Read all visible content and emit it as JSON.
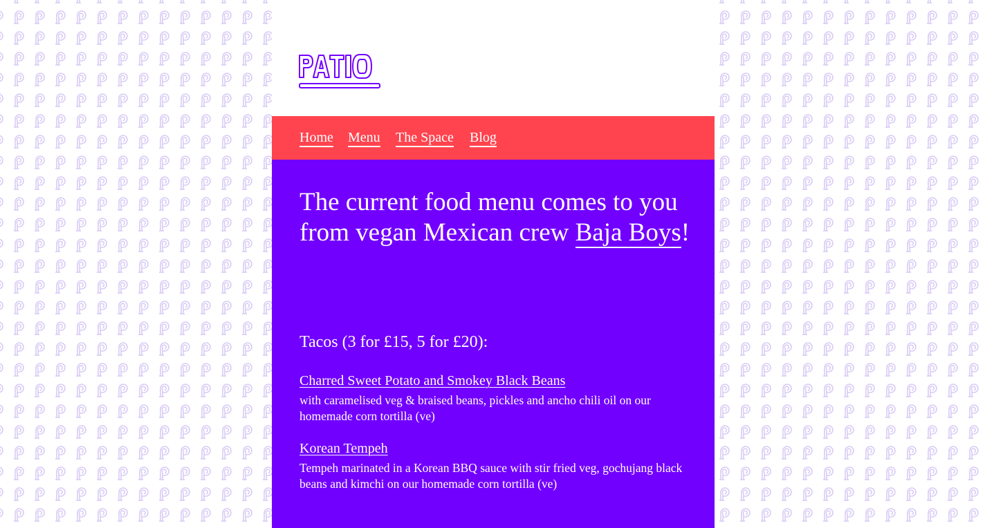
{
  "brand": {
    "logo_text": "PATIO",
    "logo_color": "#7200ff"
  },
  "colors": {
    "nav_bg": "#ff444f",
    "main_bg": "#7200ff",
    "pattern_icon": "#d9ccf5"
  },
  "nav": {
    "items": [
      {
        "label": "Home"
      },
      {
        "label": "Menu"
      },
      {
        "label": "The Space"
      },
      {
        "label": "Blog"
      }
    ]
  },
  "main": {
    "headline_prefix": "The current food menu comes to you from vegan Mexican crew ",
    "headline_link": "Baja Boys",
    "headline_suffix": "!",
    "section_title": "Tacos (3 for £15, 5 for £20):",
    "items": [
      {
        "name": "Charred Sweet Potato and Smokey Black Beans",
        "description": "with caramelised veg & braised beans, pickles and ancho chili oil on our homemade corn tortilla (ve)"
      },
      {
        "name": "Korean Tempeh",
        "description": "Tempeh marinated in a Korean BBQ sauce with stir fried veg, gochujang black beans and kimchi on our homemade corn tortilla (ve)"
      }
    ]
  },
  "background": {
    "pattern_icon": "patio-p-outline-icon"
  }
}
